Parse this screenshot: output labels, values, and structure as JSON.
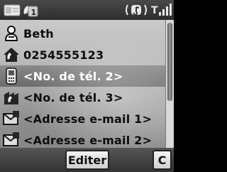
{
  "status_bar": {
    "tabs": [
      {
        "icon": "contact-card-icon"
      },
      {
        "icon": "phonebook-icon",
        "badge": "1"
      }
    ],
    "silent_icon": "vibrate-silent-icon",
    "signal_icon": "signal-strength-icon",
    "signal_text": "T"
  },
  "contact": {
    "fields": [
      {
        "icon": "name-icon",
        "label": "Beth",
        "selected": false
      },
      {
        "icon": "home-phone-icon",
        "label": "0254555123",
        "selected": false
      },
      {
        "icon": "mobile-phone-icon",
        "label": "<No. de tél. 2>",
        "selected": true
      },
      {
        "icon": "work-phone-icon",
        "label": "<No. de tél. 3>",
        "selected": false
      },
      {
        "icon": "email-icon",
        "label": "<Adresse e-mail 1>",
        "selected": false
      },
      {
        "icon": "email-icon",
        "label": "<Adresse e-mail 2>",
        "selected": false
      }
    ]
  },
  "softkeys": {
    "edit_label": "Editer",
    "clear_label": "C"
  }
}
